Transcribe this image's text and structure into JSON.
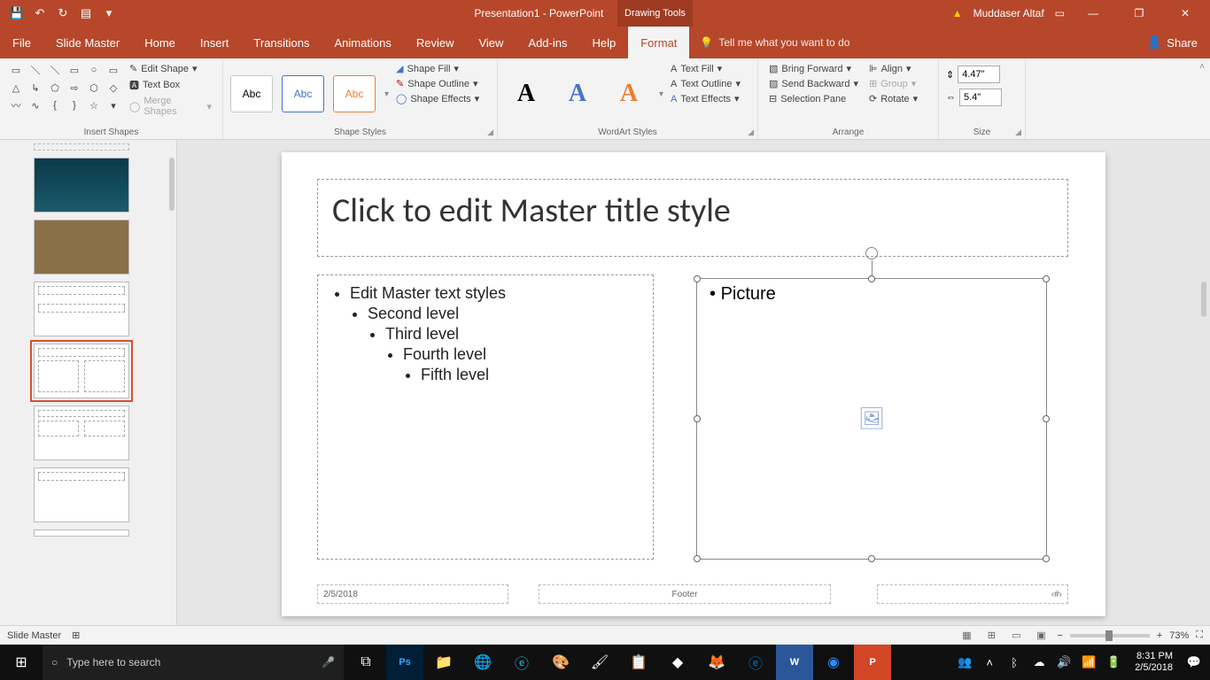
{
  "window": {
    "title": "Presentation1 - PowerPoint",
    "contextual_tab": "Drawing Tools",
    "user": "Muddaser Altaf"
  },
  "menu": {
    "file": "File",
    "slide_master": "Slide Master",
    "home": "Home",
    "insert": "Insert",
    "transitions": "Transitions",
    "animations": "Animations",
    "review": "Review",
    "view": "View",
    "addins": "Add-ins",
    "help": "Help",
    "format": "Format",
    "tell_me": "Tell me what you want to do",
    "share": "Share"
  },
  "ribbon": {
    "insert_shapes": {
      "edit_shape": "Edit Shape",
      "text_box": "Text Box",
      "merge_shapes": "Merge Shapes",
      "label": "Insert Shapes"
    },
    "shape_styles": {
      "preset_text": "Abc",
      "shape_fill": "Shape Fill",
      "shape_outline": "Shape Outline",
      "shape_effects": "Shape Effects",
      "label": "Shape Styles"
    },
    "wordart": {
      "glyph": "A",
      "text_fill": "Text Fill",
      "text_outline": "Text Outline",
      "text_effects": "Text Effects",
      "label": "WordArt Styles"
    },
    "arrange": {
      "bring_forward": "Bring Forward",
      "send_backward": "Send Backward",
      "selection_pane": "Selection Pane",
      "align": "Align",
      "group": "Group",
      "rotate": "Rotate",
      "label": "Arrange"
    },
    "size": {
      "height": "4.47\"",
      "width": "5.4\"",
      "label": "Size"
    }
  },
  "slide": {
    "title": "Click to edit Master title style",
    "bullets": {
      "l1": "Edit Master text styles",
      "l2": "Second level",
      "l3": "Third level",
      "l4": "Fourth level",
      "l5": "Fifth level"
    },
    "picture": "Picture",
    "date": "2/5/2018",
    "footer": "Footer",
    "slidenum": "‹#›"
  },
  "status": {
    "mode": "Slide Master",
    "zoom": "73%"
  },
  "taskbar": {
    "search_placeholder": "Type here to search",
    "time": "8:31 PM",
    "date": "2/5/2018"
  }
}
